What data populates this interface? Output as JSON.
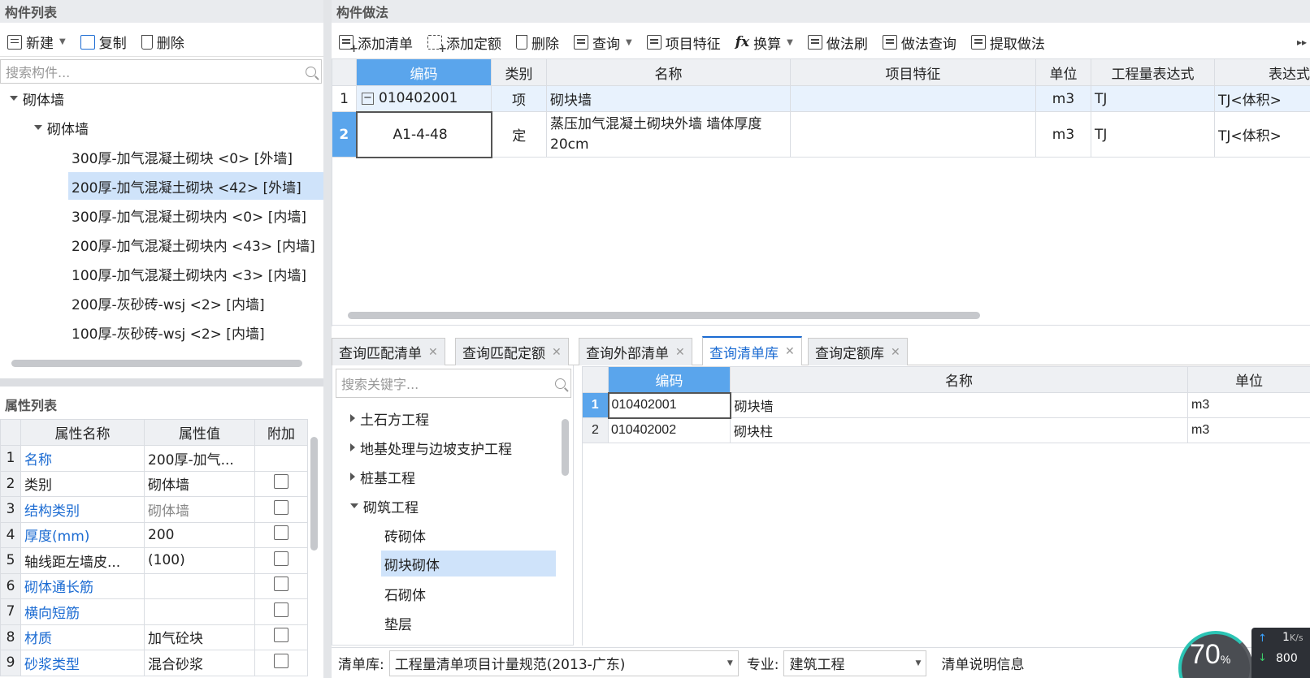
{
  "left": {
    "component_list_title": "构件列表",
    "toolbar": {
      "new_label": "新建",
      "copy_label": "复制",
      "delete_label": "删除"
    },
    "search_placeholder": "搜索构件...",
    "tree": {
      "root": "砌体墙",
      "group": "砌体墙",
      "items": [
        "300厚-加气混凝土砌块 <0> [外墙]",
        "200厚-加气混凝土砌块 <42> [外墙]",
        "300厚-加气混凝土砌块内 <0> [内墙]",
        "200厚-加气混凝土砌块内 <43> [内墙]",
        "100厚-加气混凝土砌块内 <3> [内墙]",
        "200厚-灰砂砖-wsj <2> [内墙]",
        "100厚-灰砂砖-wsj <2> [内墙]"
      ]
    },
    "property_list_title": "属性列表",
    "props": {
      "headers": [
        "属性名称",
        "属性值",
        "附加"
      ],
      "rows": [
        {
          "n": "1",
          "name": "名称",
          "value": "200厚-加气..."
        },
        {
          "n": "2",
          "name": "类别",
          "value": "砌体墙"
        },
        {
          "n": "3",
          "name": "结构类别",
          "value": "砌体墙"
        },
        {
          "n": "4",
          "name": "厚度(mm)",
          "value": "200"
        },
        {
          "n": "5",
          "name": "轴线距左墙皮...",
          "value": "(100)"
        },
        {
          "n": "6",
          "name": "砌体通长筋",
          "value": ""
        },
        {
          "n": "7",
          "name": "横向短筋",
          "value": ""
        },
        {
          "n": "8",
          "name": "材质",
          "value": "加气砼块"
        },
        {
          "n": "9",
          "name": "砂浆类型",
          "value": "混合砂浆"
        }
      ]
    }
  },
  "right": {
    "method_title": "构件做法",
    "toolbar": {
      "add_list": "添加清单",
      "add_quota": "添加定额",
      "delete": "删除",
      "query": "查询",
      "item_feature": "项目特征",
      "convert": "换算",
      "method_brush": "做法刷",
      "method_query": "做法查询",
      "extract_method": "提取做法"
    },
    "table": {
      "headers": [
        "编码",
        "类别",
        "名称",
        "项目特征",
        "单位",
        "工程量表达式",
        "表达式"
      ],
      "rows": [
        {
          "n": "1",
          "code": "010402001",
          "type": "项",
          "name": "砌块墙",
          "feature": "",
          "unit": "m3",
          "expr": "TJ",
          "expr_desc": "TJ<体积>"
        },
        {
          "n": "2",
          "code": "A1-4-48",
          "type": "定",
          "name_line1": "蒸压加气混凝土砌块外墙 墙体厚度",
          "name_line2": "20cm",
          "feature": "",
          "unit": "m3",
          "expr": "TJ",
          "expr_desc": "TJ<体积>"
        }
      ]
    },
    "tabs": [
      "查询匹配清单",
      "查询匹配定额",
      "查询外部清单",
      "查询清单库",
      "查询定额库"
    ],
    "active_tab": "查询清单库",
    "lib_search_placeholder": "搜索关键字...",
    "lib_tree": {
      "items": [
        "土石方工程",
        "地基处理与边坡支护工程",
        "桩基工程",
        "砌筑工程"
      ],
      "children": [
        "砖砌体",
        "砌块砌体",
        "石砌体",
        "垫层"
      ]
    },
    "lib_table": {
      "headers": [
        "编码",
        "名称",
        "单位"
      ],
      "rows": [
        {
          "n": "1",
          "code": "010402001",
          "name": "砌块墙",
          "unit": "m3"
        },
        {
          "n": "2",
          "code": "010402002",
          "name": "砌块柱",
          "unit": "m3"
        }
      ]
    },
    "bottom": {
      "lib_label": "清单库:",
      "lib_value": "工程量清单项目计量规范(2013-广东)",
      "major_label": "专业:",
      "major_value": "建筑工程",
      "info_label": "清单说明信息"
    },
    "widget": {
      "percent": "70",
      "unit": "%",
      "speed_up": "1",
      "speed_unit": "K/s",
      "speed_down": "800"
    }
  },
  "colors": {
    "accent": "#5aa5ec",
    "link": "#1b6bd2",
    "selected_row": "#cfe3fa"
  }
}
